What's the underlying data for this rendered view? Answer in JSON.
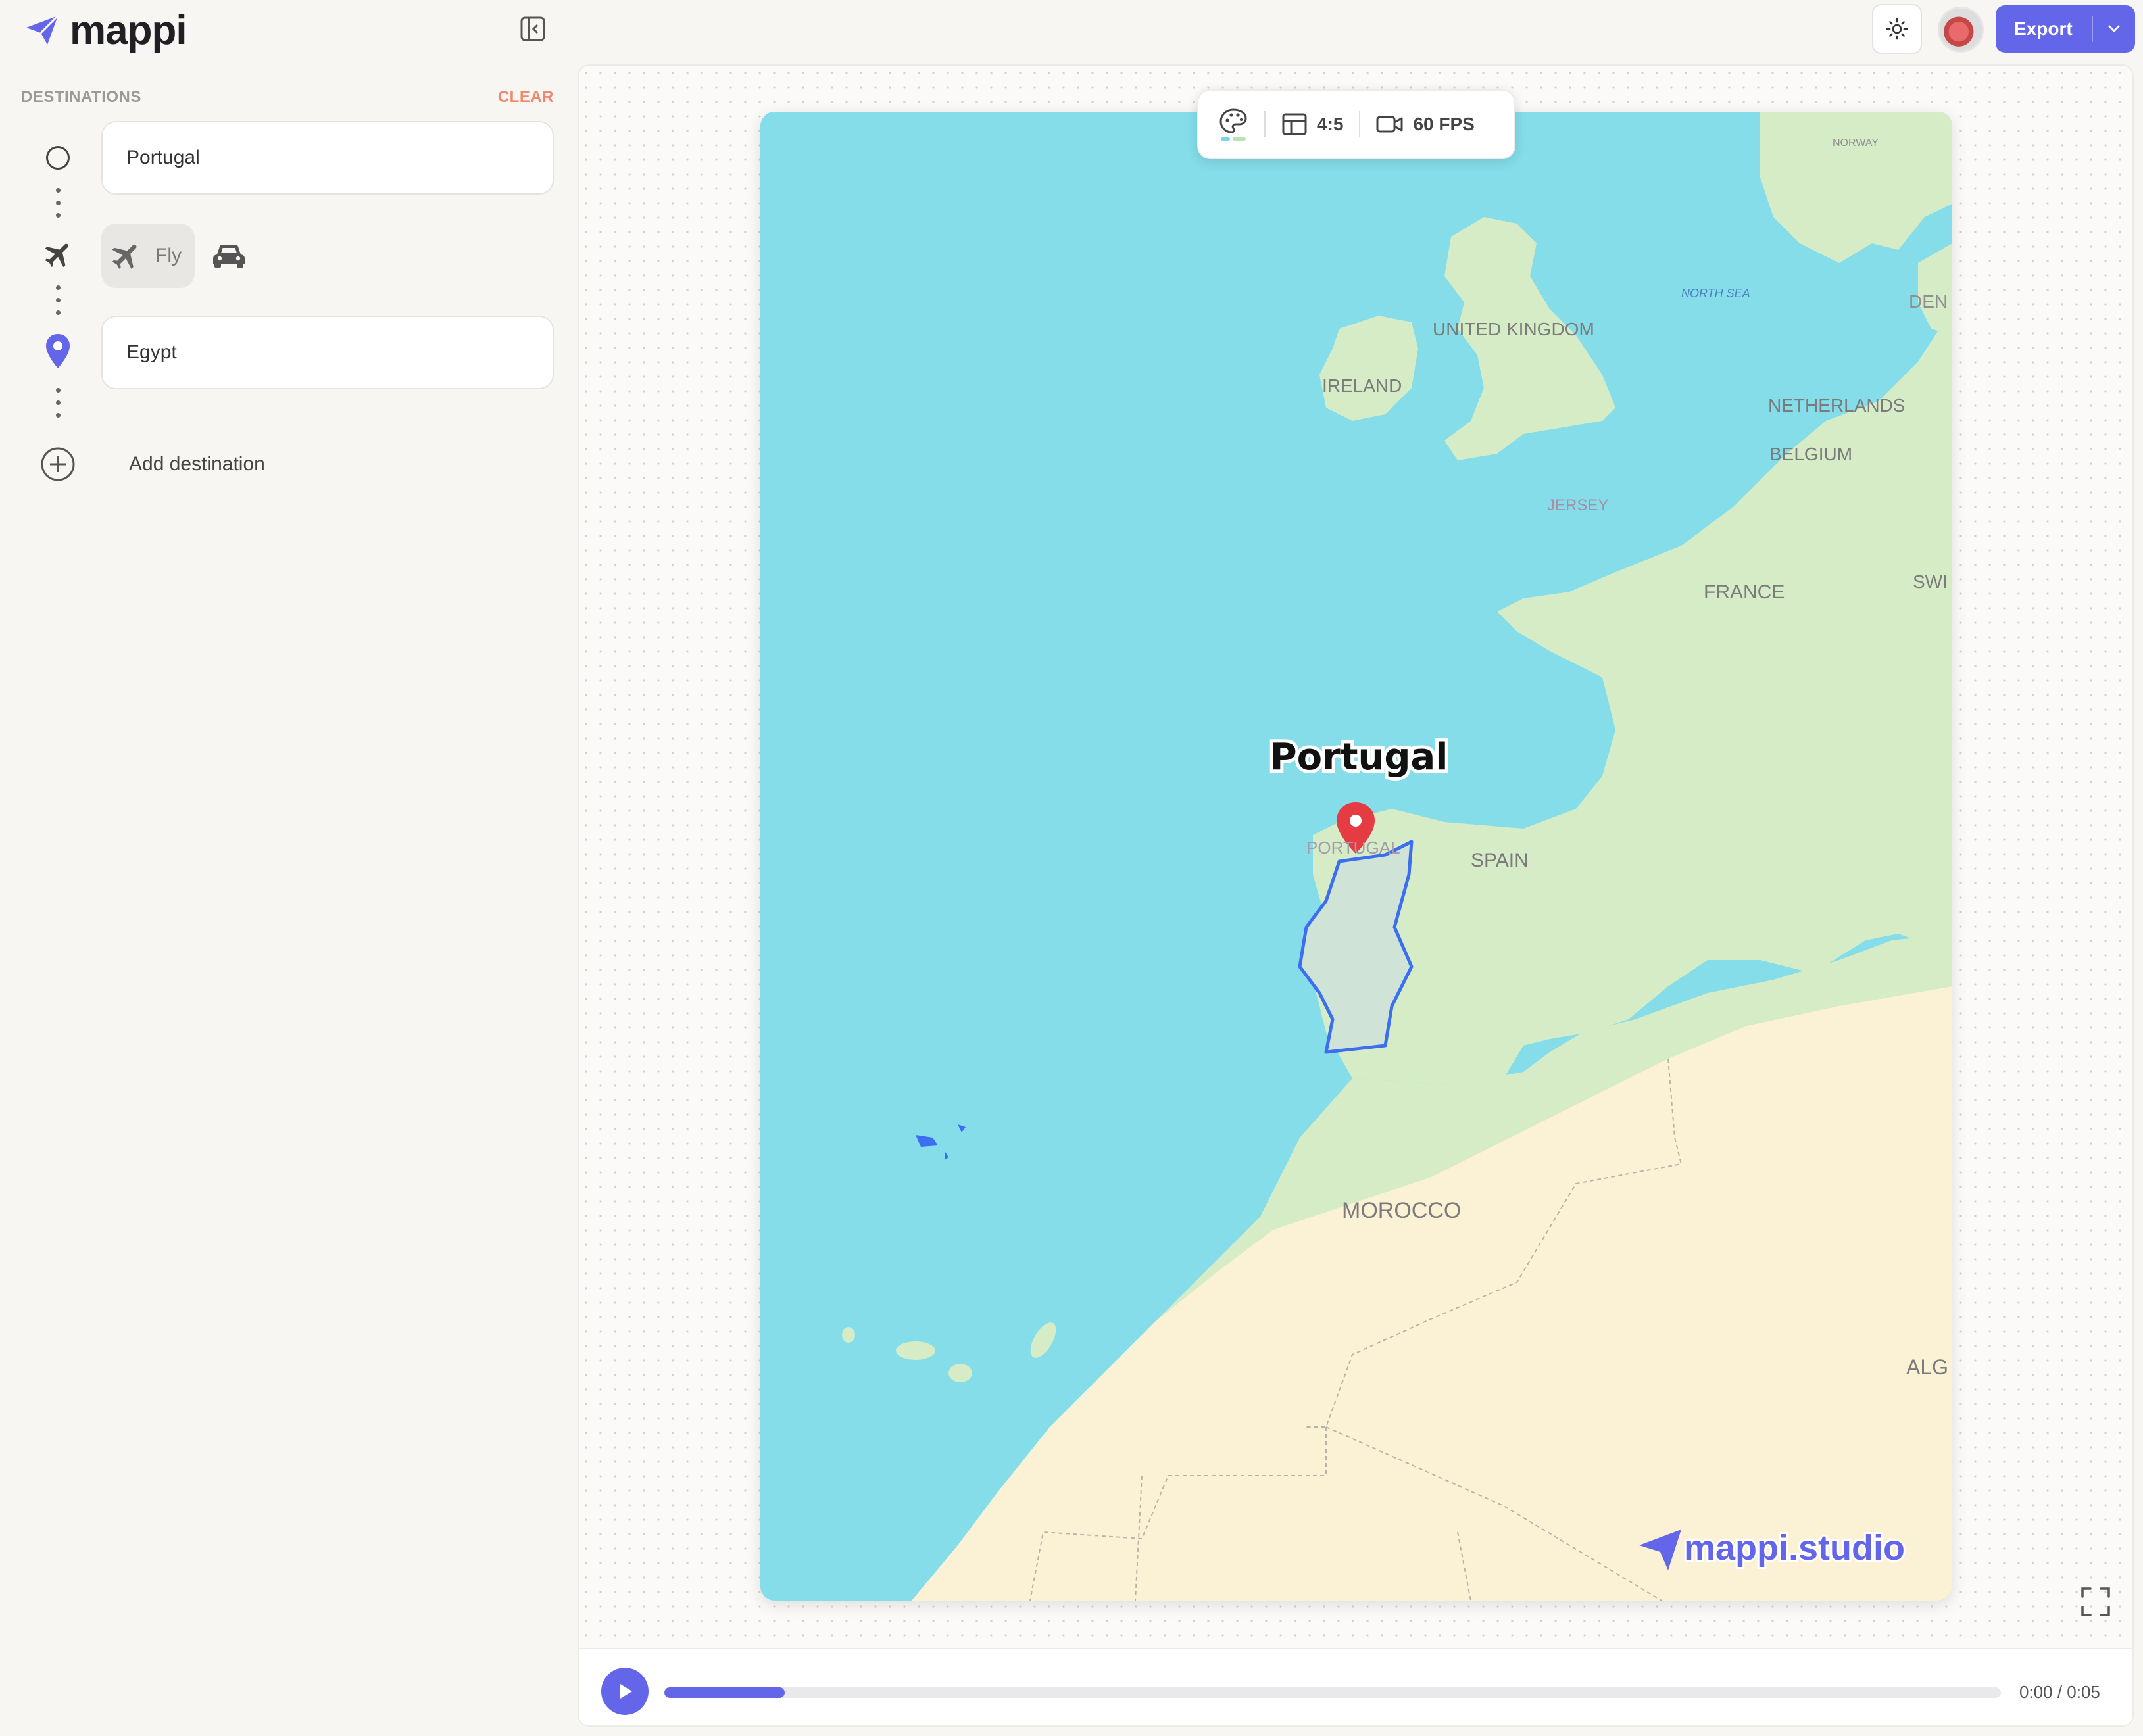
{
  "app": {
    "name": "mappi"
  },
  "sidebar": {
    "section_title": "DESTINATIONS",
    "clear_label": "CLEAR",
    "destinations": [
      {
        "value": "Portugal"
      },
      {
        "value": "Egypt"
      }
    ],
    "transport": {
      "selected": "Fly",
      "fly_label": "Fly",
      "options": [
        "plane-icon",
        "car-icon"
      ]
    },
    "add_label": "Add destination"
  },
  "header": {
    "export_label": "Export"
  },
  "toolbar": {
    "aspect": "4:5",
    "fps": "60 FPS",
    "palette_colors": [
      "#7fd3e6",
      "#b9e3b0"
    ]
  },
  "map": {
    "highlight_label": "Portugal",
    "labels": {
      "norway": "NORWAY",
      "north_sea": "NORTH SEA",
      "denmark": "DEN",
      "uk": "UNITED KINGDOM",
      "ireland": "IRELAND",
      "netherlands": "NETHERLANDS",
      "belgium": "BELGIUM",
      "jersey": "JERSEY",
      "france": "FRANCE",
      "switzerland": "SWI",
      "spain": "SPAIN",
      "portugal": "PORTUGAL",
      "morocco": "MOROCCO",
      "algeria": "ALG"
    },
    "watermark": "mappi.studio",
    "colors": {
      "water": "#84dde9",
      "land": "#d5ecc7",
      "desert": "#fbf2d6",
      "border_highlight": "#3b6ff0",
      "pin": "#e53c44"
    }
  },
  "playback": {
    "time": "0:00 / 0:05",
    "progress": 0.09
  },
  "colors": {
    "accent": "#6366e8",
    "clear": "#f2886b"
  }
}
